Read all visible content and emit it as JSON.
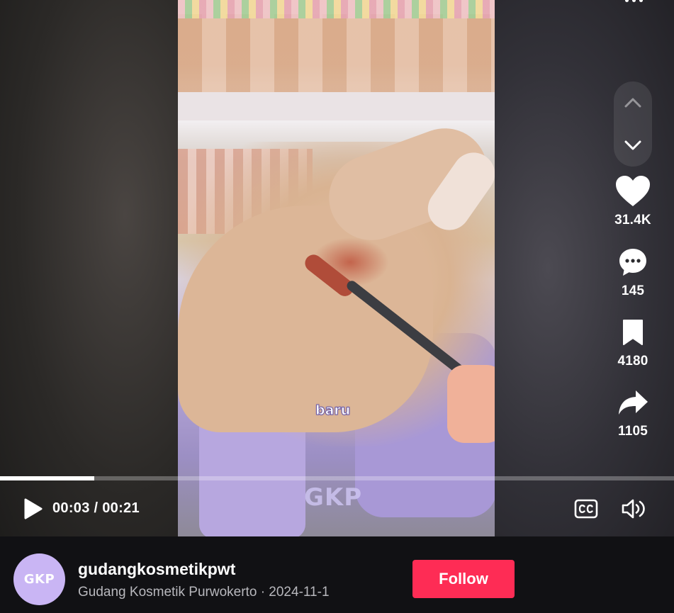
{
  "video": {
    "caption": "baru",
    "watermark": "GKP"
  },
  "actions": {
    "likes": "31.4K",
    "comments": "145",
    "saves": "4180",
    "shares": "1105"
  },
  "player": {
    "current_time": "00:03",
    "separator": "/",
    "duration": "00:21",
    "progress": 0.14
  },
  "author": {
    "avatar_text": "GKP",
    "username": "gudangkosmetikpwt",
    "display_name": "Gudang Kosmetik Purwokerto",
    "dot": "·",
    "date": "2024-11-1",
    "follow_label": "Follow"
  },
  "icons": {
    "more": "more-horizontal-icon",
    "nav_up": "chevron-up-icon",
    "nav_down": "chevron-down-icon",
    "like": "heart-icon",
    "comment": "comment-bubble-icon",
    "save": "bookmark-icon",
    "share": "share-arrow-icon",
    "play": "play-icon",
    "captions": "closed-captions-icon",
    "volume": "volume-icon"
  },
  "colors": {
    "follow": "#fe2c55",
    "background": "#111114"
  }
}
